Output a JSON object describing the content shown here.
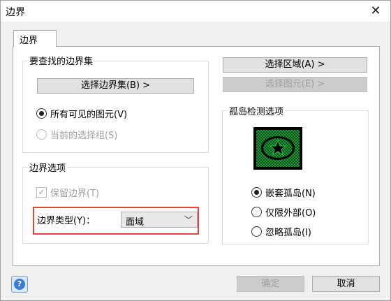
{
  "window": {
    "title": "边界"
  },
  "tabs": [
    {
      "label": "边界"
    }
  ],
  "boundary_set": {
    "group_title": "要查找的边界集",
    "select_button": "选择边界集(B) >",
    "options": [
      {
        "label": "所有可见的图元(V)",
        "checked": true,
        "enabled": true
      },
      {
        "label": "当前的选择组(S)",
        "checked": false,
        "enabled": false
      }
    ]
  },
  "boundary_options": {
    "group_title": "边界选项",
    "keep_boundary": {
      "label": "保留边界(T)",
      "checked": true,
      "enabled": false
    },
    "type_label": "边界类型(Y)：",
    "type_value": "面域"
  },
  "right_buttons": {
    "select_area": "选择区域(A) >",
    "select_primitive": "选择图元(E) >"
  },
  "island_detection": {
    "group_title": "孤岛检测选项",
    "options": [
      {
        "label": "嵌套孤岛(N)",
        "checked": true
      },
      {
        "label": "仅限外部(O)",
        "checked": false
      },
      {
        "label": "忽略孤岛(I)",
        "checked": false
      }
    ]
  },
  "footer": {
    "ok": "确定",
    "cancel": "取消"
  },
  "icons": {
    "close": "close-icon",
    "help": "help-icon",
    "dropdown": "chevron-down-icon",
    "preview": "island-preview-icon"
  },
  "colors": {
    "highlight": "#e8413c",
    "island_green": "#1e9a3a"
  }
}
